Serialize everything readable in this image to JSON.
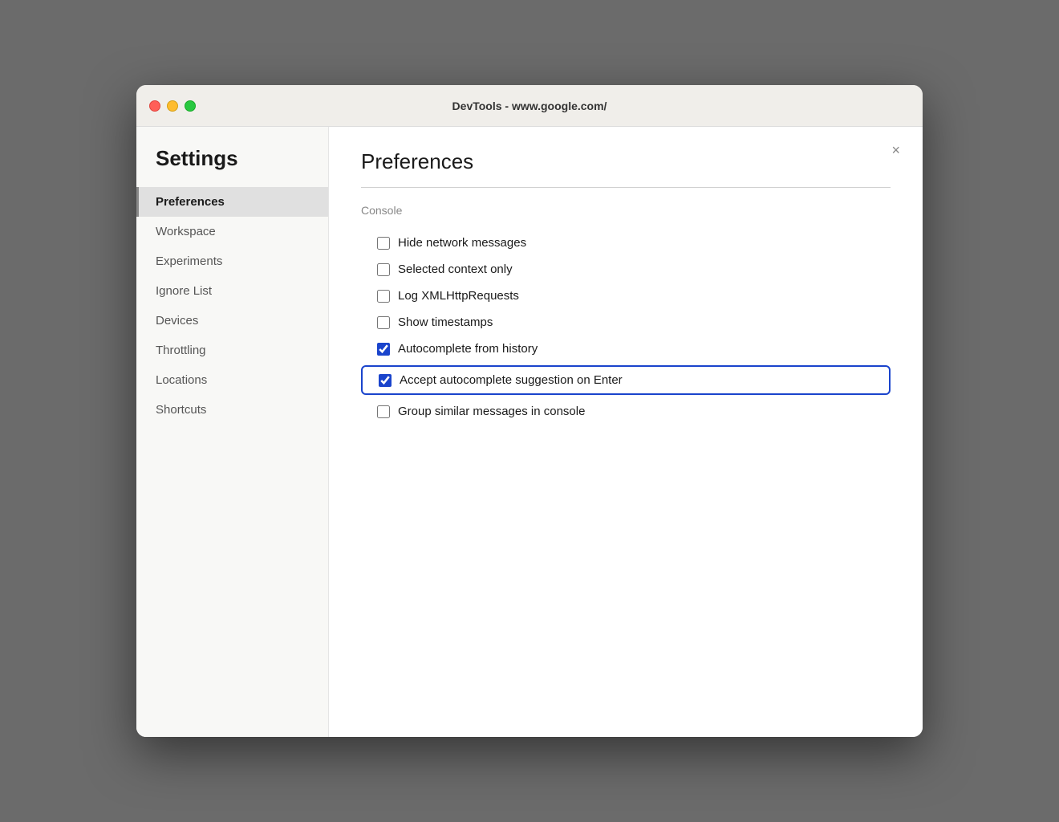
{
  "window": {
    "title": "DevTools - www.google.com/"
  },
  "sidebar": {
    "heading": "Settings",
    "items": [
      {
        "id": "preferences",
        "label": "Preferences",
        "active": true
      },
      {
        "id": "workspace",
        "label": "Workspace",
        "active": false
      },
      {
        "id": "experiments",
        "label": "Experiments",
        "active": false
      },
      {
        "id": "ignore-list",
        "label": "Ignore List",
        "active": false
      },
      {
        "id": "devices",
        "label": "Devices",
        "active": false
      },
      {
        "id": "throttling",
        "label": "Throttling",
        "active": false
      },
      {
        "id": "locations",
        "label": "Locations",
        "active": false
      },
      {
        "id": "shortcuts",
        "label": "Shortcuts",
        "active": false
      }
    ]
  },
  "main": {
    "title": "Preferences",
    "close_label": "×",
    "subsection": "Console",
    "checkboxes": [
      {
        "id": "hide-network",
        "label": "Hide network messages",
        "checked": false,
        "highlighted": false
      },
      {
        "id": "selected-context",
        "label": "Selected context only",
        "checked": false,
        "highlighted": false
      },
      {
        "id": "log-xmlhttp",
        "label": "Log XMLHttpRequests",
        "checked": false,
        "highlighted": false
      },
      {
        "id": "show-timestamps",
        "label": "Show timestamps",
        "checked": false,
        "highlighted": false
      },
      {
        "id": "autocomplete-history",
        "label": "Autocomplete from history",
        "checked": true,
        "highlighted": false
      },
      {
        "id": "accept-autocomplete",
        "label": "Accept autocomplete suggestion on Enter",
        "checked": true,
        "highlighted": true
      },
      {
        "id": "group-similar",
        "label": "Group similar messages in console",
        "checked": false,
        "highlighted": false
      }
    ]
  },
  "colors": {
    "close": "#ff5f57",
    "minimize": "#febc2e",
    "maximize": "#28c840",
    "highlight_border": "#1a44cc"
  }
}
